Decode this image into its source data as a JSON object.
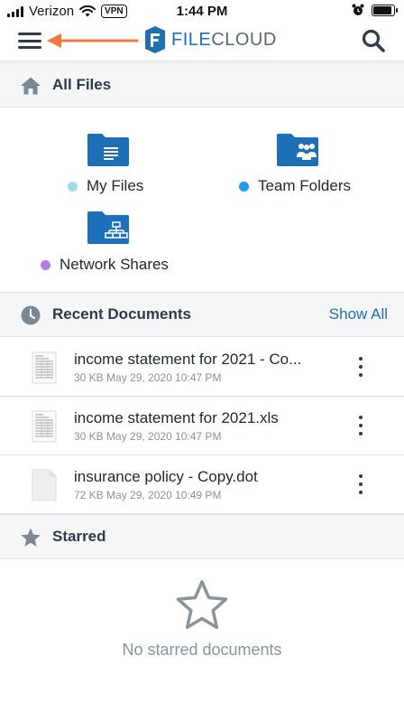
{
  "status_bar": {
    "carrier": "Verizon",
    "vpn": "VPN",
    "time": "1:44 PM"
  },
  "app_bar": {
    "logo_text_prefix": "FILE",
    "logo_text_suffix": "CLOUD",
    "accent_color": "#1f6fb5",
    "annotation_arrow_color": "#f07a3c"
  },
  "all_files": {
    "title": "All Files",
    "folders": [
      {
        "label": "My Files",
        "dot_color": "#9adfe6",
        "icon": "folder-lines-icon"
      },
      {
        "label": "Team Folders",
        "dot_color": "#1e9be9",
        "icon": "folder-team-icon"
      },
      {
        "label": "Network Shares",
        "dot_color": "#b27ee8",
        "icon": "folder-network-icon"
      }
    ]
  },
  "recent": {
    "title": "Recent Documents",
    "show_all": "Show All",
    "documents": [
      {
        "name": "income statement for 2021 - Co...",
        "meta": "30 KB May 29, 2020 10:47 PM",
        "thumb": "spreadsheet-thumb"
      },
      {
        "name": "income statement for 2021.xls",
        "meta": "30 KB May 29, 2020 10:47 PM",
        "thumb": "spreadsheet-thumb"
      },
      {
        "name": "insurance policy - Copy.dot",
        "meta": "72 KB May 29, 2020 10:49 PM",
        "thumb": "blank-doc-thumb"
      }
    ]
  },
  "starred": {
    "title": "Starred",
    "empty_text": "No starred documents"
  }
}
